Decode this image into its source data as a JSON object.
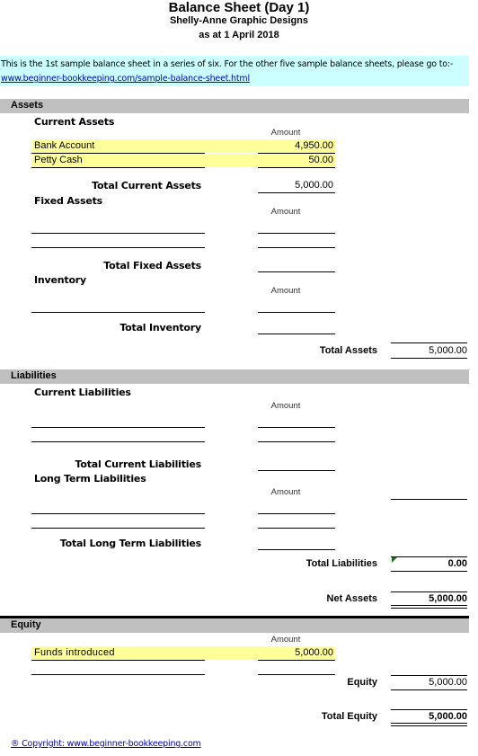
{
  "header": {
    "title": "Balance Sheet (Day 1)",
    "company": "Shelly-Anne Graphic Designs",
    "date": "as at 1 April 2018"
  },
  "note": {
    "text": "This is the 1st sample balance sheet in a series of six. For the other five sample balance sheets, please go to:-",
    "link": "www.beginner-bookkeeping.com/sample-balance-sheet.html"
  },
  "assets": {
    "heading": "Assets",
    "current": {
      "heading": "Current Assets",
      "amount_header": "Amount",
      "items": [
        {
          "label": "Bank Account",
          "amount": "4,950.00"
        },
        {
          "label": "Petty Cash",
          "amount": "50.00"
        }
      ],
      "total_label": "Total Current Assets",
      "total": "5,000.00"
    },
    "fixed": {
      "heading": "Fixed Assets",
      "amount_header": "Amount",
      "total_label": "Total Fixed Assets",
      "total": ""
    },
    "inventory": {
      "heading": "Inventory",
      "amount_header": "Amount",
      "total_label": "Total Inventory",
      "total": ""
    },
    "total_label": "Total Assets",
    "total": "5,000.00"
  },
  "liabilities": {
    "heading": "Liabilities",
    "current": {
      "heading": "Current Liabilities",
      "amount_header": "Amount",
      "total_label": "Total Current Liabilities",
      "total": ""
    },
    "long_term": {
      "heading": "Long Term Liabilities",
      "amount_header": "Amount",
      "total_label": "Total Long Term Liabilities",
      "total": ""
    },
    "total_label": "Total Liabilities",
    "total": "0.00"
  },
  "net_assets": {
    "label": "Net Assets",
    "value": "5,000.00"
  },
  "equity": {
    "heading": "Equity",
    "amount_header": "Amount",
    "items": [
      {
        "label": "Funds introduced",
        "amount": "5,000.00"
      }
    ],
    "subtotal_label": "Equity",
    "subtotal": "5,000.00",
    "total_label": "Total Equity",
    "total": "5,000.00"
  },
  "footer": {
    "copyright": "® Copyright: www.beginner-bookkeeping.com"
  },
  "colors": {
    "input_highlight": "#ffff99",
    "note_background": "#ccffff",
    "section_band": "#c0c0c0",
    "link": "#0000cc"
  }
}
